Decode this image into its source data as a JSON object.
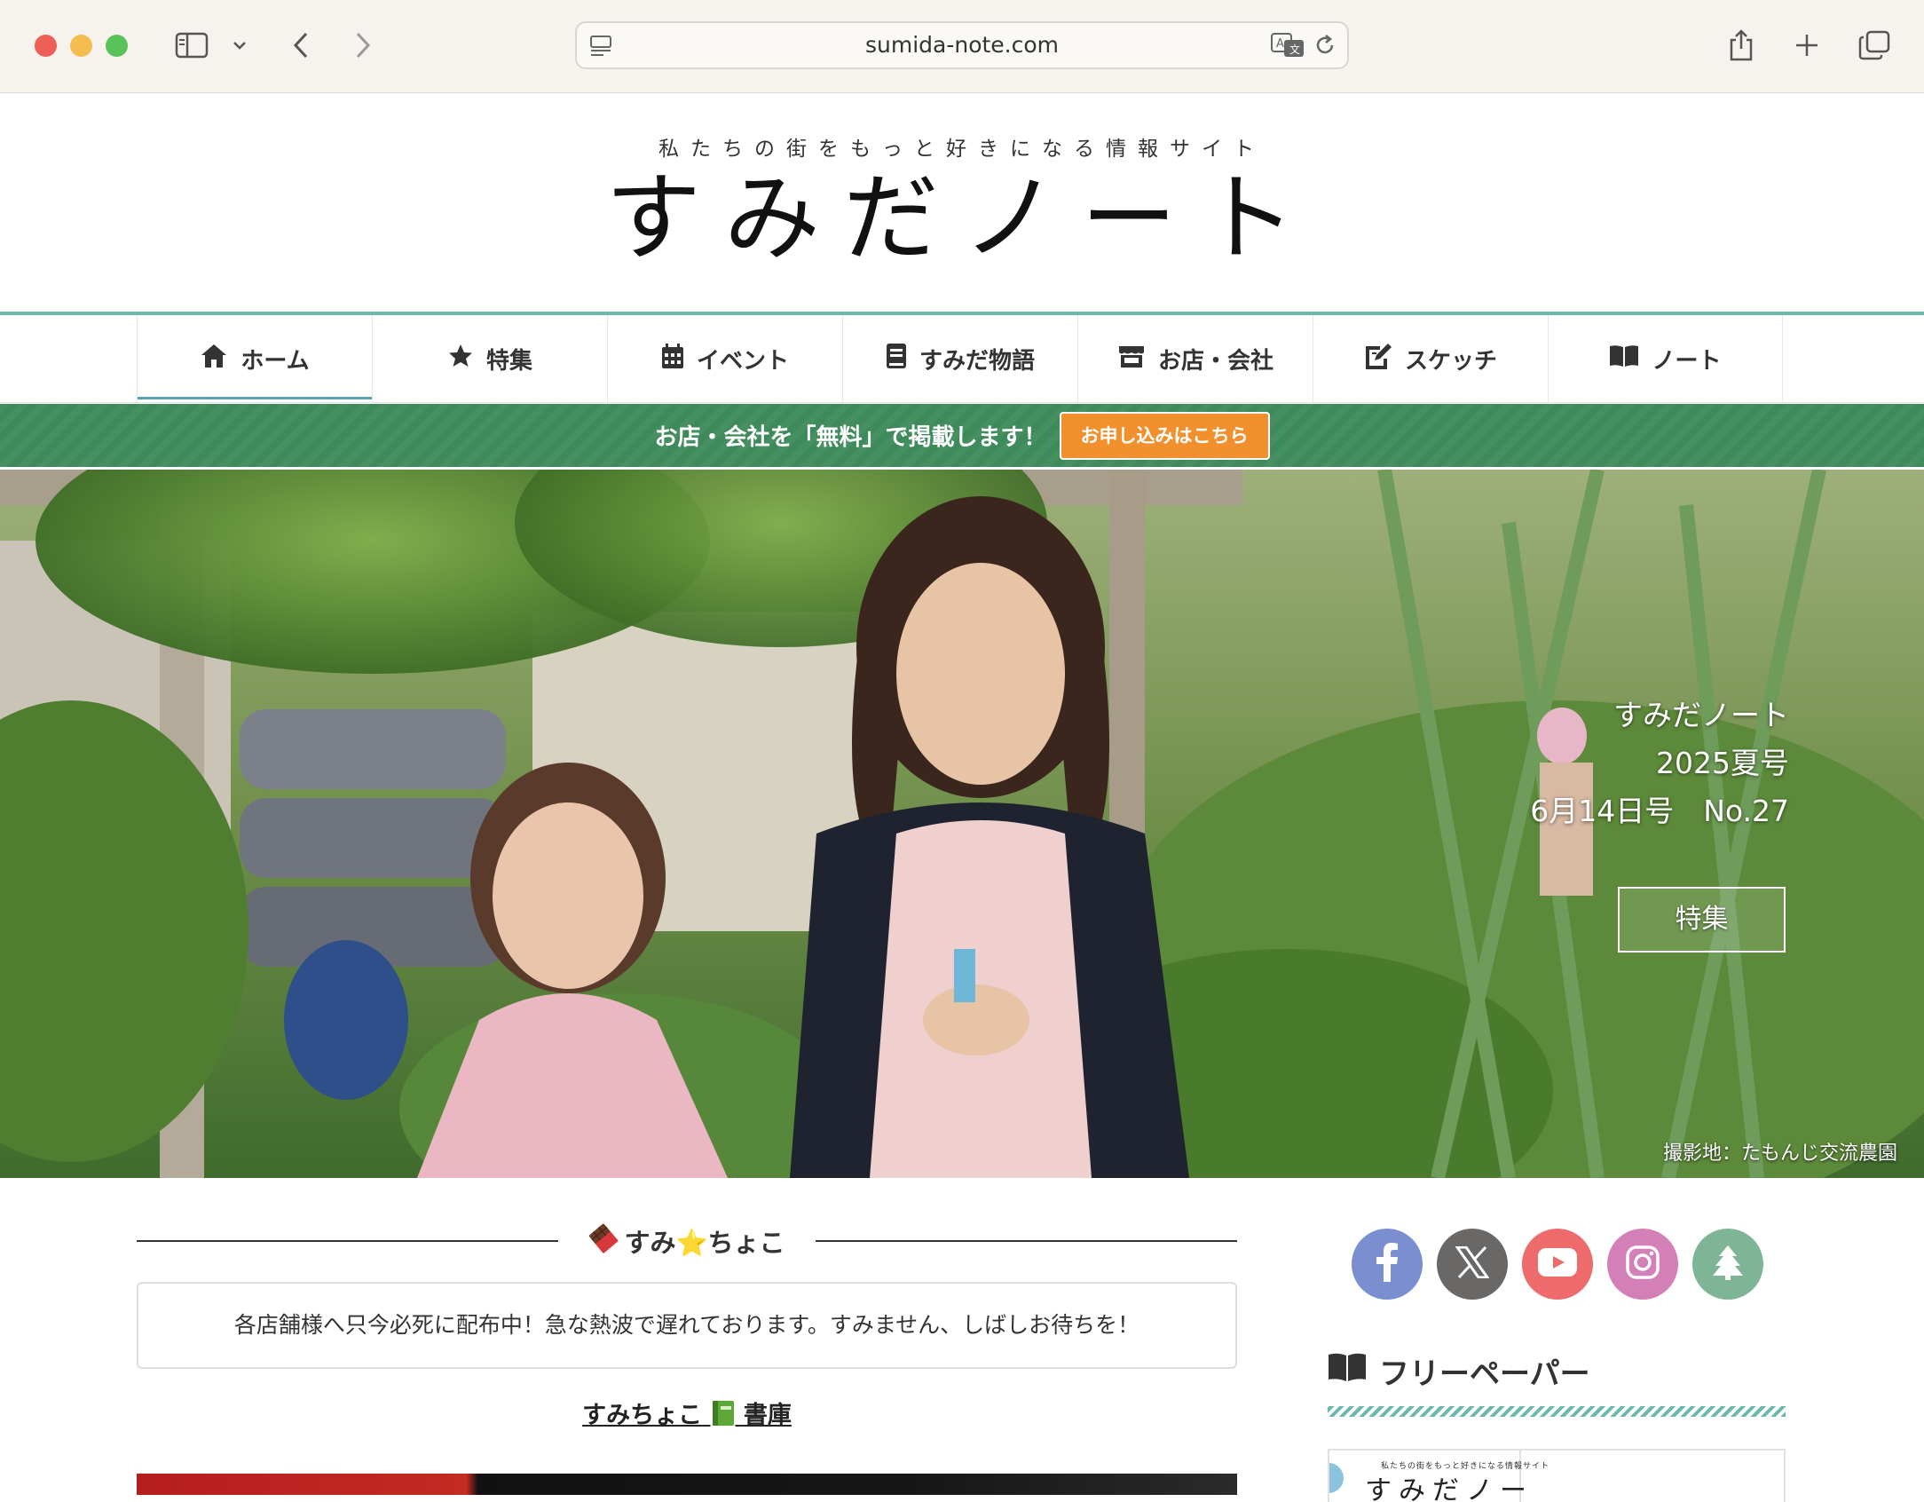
{
  "browser": {
    "url": "sumida-note.com"
  },
  "site": {
    "tagline": "私たちの街をもっと好きになる情報サイト",
    "title": "すみだノート"
  },
  "nav": {
    "items": [
      {
        "label": "ホーム",
        "icon": "home-icon"
      },
      {
        "label": "特集",
        "icon": "star-icon"
      },
      {
        "label": "イベント",
        "icon": "calendar-icon"
      },
      {
        "label": "すみだ物語",
        "icon": "book-icon"
      },
      {
        "label": "お店・会社",
        "icon": "store-icon"
      },
      {
        "label": "スケッチ",
        "icon": "sketch-icon"
      },
      {
        "label": "ノート",
        "icon": "open-book-icon"
      }
    ]
  },
  "banner": {
    "text": "お店・会社を「無料」で掲載します！",
    "button": "お申し込みはこちら"
  },
  "hero": {
    "caption_line1": "すみだノート",
    "caption_line2": "2025夏号",
    "caption_line3": "6月14日号　No.27",
    "button": "特集",
    "credit": "撮影地：たもんじ交流農園"
  },
  "main": {
    "section_title": "すみ⭐ちょこ",
    "section_icon": "chocolate-icon",
    "notice": "各店舗様へ只今必死に配布中！急な熱波で遅れております。すみません、しばしお待ちを！",
    "library_link_pre": "すみちょこ",
    "library_link_post": "書庫",
    "library_icon": "green-book-icon"
  },
  "sidebar": {
    "social": [
      {
        "icon": "facebook-icon",
        "color": "#7b8fd0"
      },
      {
        "icon": "x-icon",
        "color": "#6a6867"
      },
      {
        "icon": "youtube-icon",
        "color": "#ed6b6b"
      },
      {
        "icon": "instagram-icon",
        "color": "#d37fb8"
      },
      {
        "icon": "tree-icon",
        "color": "#7db596"
      }
    ],
    "freepaper_title": "フリーペーパー",
    "paper_tagline": "私たちの街をもっと好きになる情報サイト",
    "paper_title": "すみだノー"
  },
  "colors": {
    "accent_teal": "#6bb8ac",
    "banner_green": "#3e8a5a",
    "cta_orange": "#f2902d"
  }
}
